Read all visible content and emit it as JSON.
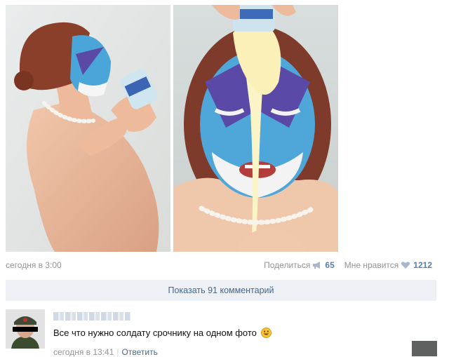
{
  "post": {
    "timestamp": "сегодня в 3:00",
    "share_label": "Поделиться",
    "share_count": "65",
    "like_label": "Мне нравится",
    "like_count": "1212"
  },
  "comments_button": "Показать 91 комментарий",
  "comment": {
    "text": "Все что нужно солдату срочнику на одном фото",
    "time": "сегодня в 13:41",
    "separator": "|",
    "reply_label": "Ответить"
  },
  "icons": [
    "megaphone-icon",
    "heart-icon",
    "smiley-icon"
  ],
  "colors": {
    "link": "#45688e",
    "muted": "#939393",
    "bar_bg": "#edf1f5"
  }
}
